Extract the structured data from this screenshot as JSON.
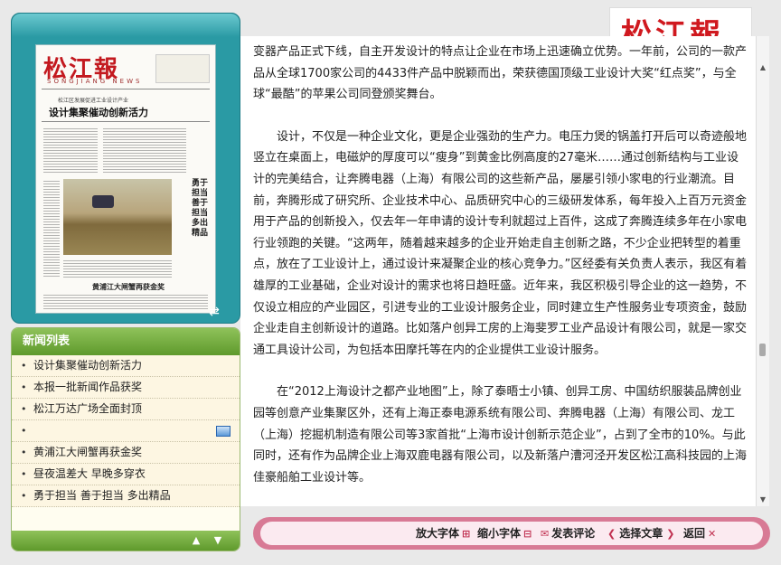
{
  "brand": {
    "title": "松江報"
  },
  "newspaper": {
    "masthead": "松江報",
    "masthead_sub": "SONGJIANG NEWS",
    "kicker": "松江区发展促进工业设计产业",
    "headline": "设计集聚催动创新活力",
    "side_head": "勇于担当 善于担当 多出精品",
    "small_head": "黄浦江大闸蟹再获金奖"
  },
  "news_list": {
    "title": "新闻列表",
    "items": [
      {
        "label": "设计集聚催动创新活力",
        "has_image": false
      },
      {
        "label": "本报一批新闻作品获奖",
        "has_image": false
      },
      {
        "label": "松江万达广场全面封顶",
        "has_image": false
      },
      {
        "label": "",
        "has_image": true
      },
      {
        "label": "黄浦江大闸蟹再获金奖",
        "has_image": false
      },
      {
        "label": "昼夜温差大 早晚多穿衣",
        "has_image": false
      },
      {
        "label": "勇于担当 善于担当 多出精品",
        "has_image": false
      }
    ]
  },
  "article": {
    "first_line": "变器产品正式下线，自主开发设计的特点让企业在市场上迅速确立优势。一年前，公司的一款产品从全球1700家公司的4433件产品中脱颖而出，荣获德国顶级工业设计大奖“红点奖”，与全球“最酷”的苹果公司同登颁奖舞台。",
    "para2": "设计，不仅是一种企业文化，更是企业强劲的生产力。电压力煲的锅盖打开后可以奇迹般地竖立在桌面上，电磁炉的厚度可以“瘦身”到黄金比例高度的27毫米……通过创新结构与工业设计的完美结合，让奔腾电器（上海）有限公司的这些新产品，屡屡引领小家电的行业潮流。目前，奔腾形成了研究所、企业技术中心、品质研究中心的三级研发体系，每年投入上百万元资金用于产品的创新投入，仅去年一年申请的设计专利就超过上百件，这成了奔腾连续多年在小家电行业领跑的关键。“这两年，随着越来越多的企业开始走自主创新之路，不少企业把转型的着重点，放在了工业设计上，通过设计来凝聚企业的核心竞争力。”区经委有关负责人表示，我区有着雄厚的工业基础，企业对设计的需求也将日趋旺盛。近年来，我区积极引导企业的这一趋势，不仅设立相应的产业园区，引进专业的工业设计服务企业，同时建立生产性服务业专项资金，鼓励企业走自主创新设计的道路。比如落户创异工房的上海斐罗工业产品设计有限公司，就是一家交通工具设计公司，为包括本田摩托等在内的企业提供工业设计服务。",
    "para3": "在“2012上海设计之都产业地图”上，除了泰晤士小镇、创异工房、中国纺织服装品牌创业园等创意产业集聚区外，还有上海正泰电源系统有限公司、奔腾电器（上海）有限公司、龙工（上海）挖掘机制造有限公司等3家首批“上海市设计创新示范企业”，占到了全市的10%。与此同时，还有作为品牌企业上海双鹿电器有限公司，以及新落户漕河泾开发区松江高科技园的上海佳豪船舶工业设计等。"
  },
  "toolbar": {
    "zoom_in": "放大字体",
    "zoom_out": "缩小字体",
    "comment": "发表评论",
    "select": "选择文章",
    "back": "返回"
  }
}
